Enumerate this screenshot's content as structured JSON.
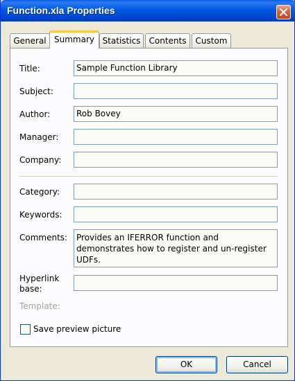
{
  "window": {
    "title": "Function.xla Properties"
  },
  "icons": {
    "close": "close-icon"
  },
  "tabs": [
    {
      "label": "General",
      "active": false
    },
    {
      "label": "Summary",
      "active": true
    },
    {
      "label": "Statistics",
      "active": false
    },
    {
      "label": "Contents",
      "active": false
    },
    {
      "label": "Custom",
      "active": false
    }
  ],
  "form": {
    "title": {
      "label": "Title:",
      "value": "Sample Function Library"
    },
    "subject": {
      "label": "Subject:",
      "value": ""
    },
    "author": {
      "label": "Author:",
      "value": "Rob Bovey"
    },
    "manager": {
      "label": "Manager:",
      "value": ""
    },
    "company": {
      "label": "Company:",
      "value": ""
    },
    "category": {
      "label": "Category:",
      "value": ""
    },
    "keywords": {
      "label": "Keywords:",
      "value": ""
    },
    "comments": {
      "label": "Comments:",
      "value": "Provides an IFERROR function and demonstrates how to register and un-register UDFs."
    },
    "hyperlink_base": {
      "label_line1": "Hyperlink",
      "label_line2": "base:",
      "value": ""
    },
    "template": {
      "label": "Template:"
    },
    "save_preview": {
      "label": "Save preview picture",
      "checked": false
    }
  },
  "buttons": {
    "ok": "OK",
    "cancel": "Cancel"
  },
  "colors": {
    "titlebar": "#0058e3",
    "active_tab_accent": "#ffc83c",
    "dialog_bg": "#ece9d8"
  }
}
